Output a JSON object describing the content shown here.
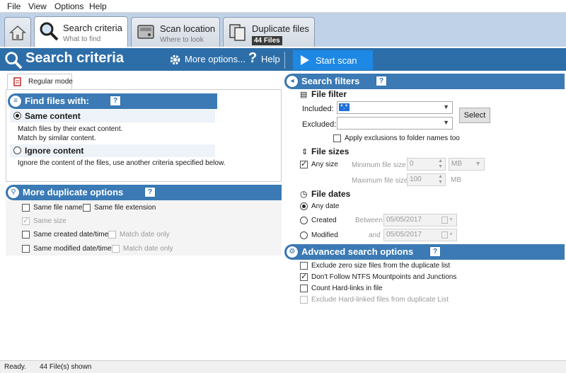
{
  "menu": {
    "file": "File",
    "view": "View",
    "options": "Options",
    "help": "Help"
  },
  "tabs": [
    {
      "title": "Search criteria",
      "subtitle": "What to find"
    },
    {
      "title": "Scan location",
      "subtitle": "Where to look"
    },
    {
      "title": "Duplicate files",
      "badge": "44 Files"
    }
  ],
  "header": {
    "title": "Search criteria",
    "more_options": "More options...",
    "help": "Help",
    "start_scan": "Start scan"
  },
  "mode_tab": "Regular mode",
  "find_files": {
    "title": "Find files with:",
    "same_content": "Same content",
    "same_content_desc1": "Match files by their exact content.",
    "same_content_desc2": "Match by similar content.",
    "ignore_content": "Ignore content",
    "ignore_content_desc": "Ignore the content of the files, use another criteria specified below."
  },
  "more_dup": {
    "title": "More duplicate options",
    "same_file_name": "Same file name",
    "same_file_ext": "Same file extension",
    "same_size": "Same size",
    "same_created": "Same created date/time",
    "match_date_only_1": "Match date only",
    "same_modified": "Same modified date/time",
    "match_date_only_2": "Match date only"
  },
  "filters": {
    "title": "Search filters",
    "file_filter": "File filter",
    "included_label": "Included:",
    "included_value": "*.*",
    "excluded_label": "Excluded:",
    "select_button": "Select",
    "apply_exclusions": "Apply exclusions to folder names too",
    "file_sizes": "File sizes",
    "any_size": "Any size",
    "min_size_label": "Minimum file size",
    "min_size_value": "0",
    "min_unit": "MB",
    "max_size_label": "Maximum file size",
    "max_size_value": "100",
    "max_unit": "MB",
    "file_dates": "File dates",
    "any_date": "Any date",
    "created": "Created",
    "between": "Between",
    "created_date": "05/05/2017",
    "modified": "Modified",
    "and": "and",
    "modified_date": "05/05/2017"
  },
  "advanced": {
    "title": "Advanced search options",
    "opt1": "Exclude zero size files from the duplicate list",
    "opt2": "Don't Follow NTFS Mountpoints and Junctions",
    "opt3": "Count Hard-links in file",
    "opt4": "Exclude Hard-linked files from duplicate List"
  },
  "status": {
    "ready": "Ready.",
    "files_shown": "44 File(s) shown"
  }
}
